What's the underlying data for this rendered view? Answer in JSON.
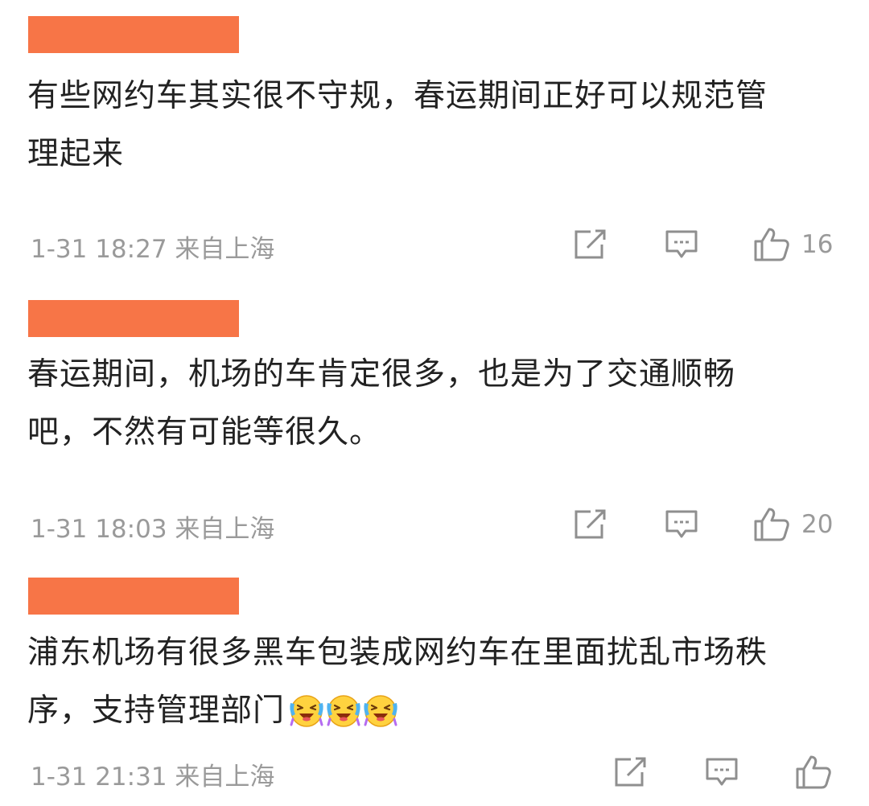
{
  "comments": [
    {
      "text_line1": "有些网约车其实很不守规，春运期间正好可以规范管",
      "text_line2": "理起来",
      "time": "1-31 18:27",
      "location": "来自上海",
      "likes": "16",
      "emoji_count": 0
    },
    {
      "text_line1": "春运期间，机场的车肯定很多，也是为了交通顺畅",
      "text_line2": "吧，不然有可能等很久。",
      "time": "1-31 18:03",
      "location": "来自上海",
      "likes": "20",
      "emoji_count": 0
    },
    {
      "text_line1": "浦东机场有很多黑车包装成网约车在里面扰乱市场秩",
      "text_line2": "序，支持管理部门",
      "time": "1-31 21:31",
      "location": "来自上海",
      "likes": "",
      "emoji_count": 3
    }
  ],
  "icons": {
    "share": "share-icon",
    "reply": "reply-icon",
    "like": "thumbs-up-icon",
    "emoji": "crying-laughing-emoji-icon"
  },
  "colors": {
    "name_redaction": "#f77547",
    "meta_text": "#9a9a9a",
    "body_text": "#222222"
  }
}
